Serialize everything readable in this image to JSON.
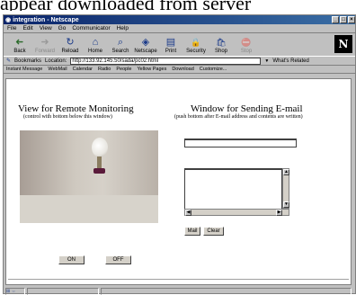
{
  "above_text": "appear  downloaded  from  server",
  "window": {
    "title": "integration - Netscape",
    "controls": [
      "_",
      "□",
      "×"
    ]
  },
  "menu": [
    "File",
    "Edit",
    "View",
    "Go",
    "Communicator",
    "Help"
  ],
  "toolbar": {
    "buttons": [
      {
        "label": "Back",
        "icon": "back-icon",
        "glyph": "➜",
        "enabled": true
      },
      {
        "label": "Forward",
        "icon": "forward-icon",
        "glyph": "➜",
        "enabled": false
      },
      {
        "label": "Reload",
        "icon": "reload-icon",
        "glyph": "↻",
        "enabled": true
      },
      {
        "label": "Home",
        "icon": "home-icon",
        "glyph": "⌂",
        "enabled": true
      },
      {
        "label": "Search",
        "icon": "search-icon",
        "glyph": "⌕",
        "enabled": true
      },
      {
        "label": "Netscape",
        "icon": "netscape-icon",
        "glyph": "◈",
        "enabled": true
      },
      {
        "label": "Print",
        "icon": "print-icon",
        "glyph": "▤",
        "enabled": true
      },
      {
        "label": "Security",
        "icon": "security-icon",
        "glyph": "🔒",
        "enabled": true
      },
      {
        "label": "Shop",
        "icon": "shop-icon",
        "glyph": "🛍",
        "enabled": true
      },
      {
        "label": "Stop",
        "icon": "stop-icon",
        "glyph": "⛔",
        "enabled": false
      }
    ],
    "logo": "N"
  },
  "location": {
    "bookmarks": "Bookmarks",
    "label": "Location:",
    "url": "http://133.92.145.50/sada/pc02.html",
    "related": "What's Related"
  },
  "personal": [
    "Instant Message",
    "WebMail",
    "Calendar",
    "Radio",
    "People",
    "Yellow Pages",
    "Download",
    "Customize..."
  ],
  "page": {
    "left_heading": "View for Remote Monitoring",
    "left_sub": "(control with bottom below this window)",
    "right_heading": "Window for Sending E-mail",
    "right_sub": "(push bottom after E-mail address and contents are written)",
    "on_button": "ON",
    "off_button": "OFF",
    "mail_button": "Mail",
    "clear_button": "Clear"
  }
}
